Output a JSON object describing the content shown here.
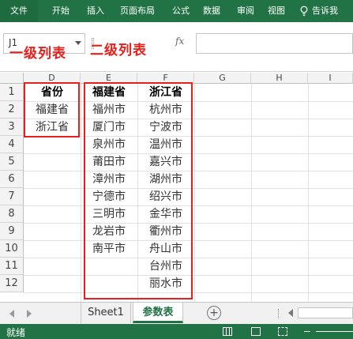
{
  "ribbon": {
    "tabs": [
      "文件",
      "开始",
      "插入",
      "页面布局",
      "公式",
      "数据",
      "审阅",
      "视图"
    ],
    "tell_me": "告诉我"
  },
  "formula_bar": {
    "name_box": "J1",
    "fx": "fx",
    "value": ""
  },
  "annotations": {
    "level1": "一级列表",
    "level2": "二级列表"
  },
  "grid": {
    "columns": [
      "D",
      "E",
      "F",
      "G",
      "H",
      "I"
    ],
    "rows": [
      "1",
      "2",
      "3",
      "4",
      "5",
      "6",
      "7",
      "8",
      "9",
      "10",
      "11",
      "12"
    ],
    "col_d": [
      "省份",
      "福建省",
      "浙江省"
    ],
    "col_e": [
      "福建省",
      "福州市",
      "厦门市",
      "泉州市",
      "莆田市",
      "漳州市",
      "宁德市",
      "三明市",
      "龙岩市",
      "南平市"
    ],
    "col_f": [
      "浙江省",
      "杭州市",
      "宁波市",
      "温州市",
      "嘉兴市",
      "湖州市",
      "绍兴市",
      "金华市",
      "衢州市",
      "舟山市",
      "台州市",
      "丽水市"
    ]
  },
  "sheets": {
    "tabs": [
      "Sheet1",
      "参数表"
    ],
    "active": "参数表",
    "add_label": "+"
  },
  "status": {
    "ready": "就绪"
  },
  "colors": {
    "excel_green": "#217346",
    "annotation_red": "#e8201c"
  }
}
